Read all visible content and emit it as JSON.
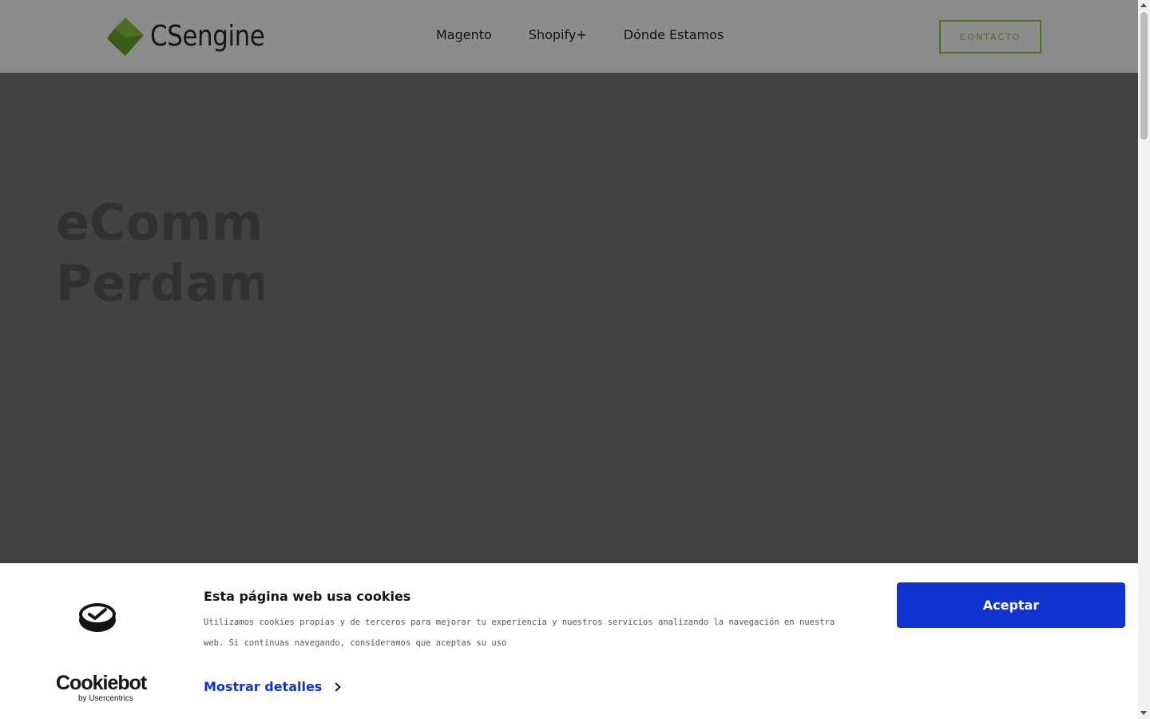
{
  "brand": {
    "name": "CSengine",
    "accent": "#8ec73c"
  },
  "nav": {
    "items": [
      {
        "label": "Magento"
      },
      {
        "label": "Shopify+"
      },
      {
        "label": "Dónde Estamos"
      }
    ],
    "contact_label": "CONTACTO"
  },
  "hero": {
    "line1": "eComm",
    "line2": "Perdam i"
  },
  "cookie_banner": {
    "title": "Esta página web usa cookies",
    "text": "Utilizamos cookies propias y de terceros para mejorar tu experiencia y nuestros servicios analizando la navegación en nuestra web. Si continuas navegando, consideramos que aceptas su uso",
    "details_label": "Mostrar detalles",
    "accept_label": "Aceptar",
    "logo_main": "Cookiebot",
    "logo_sub": "by Usercentrics",
    "accent": "#1032cf"
  }
}
